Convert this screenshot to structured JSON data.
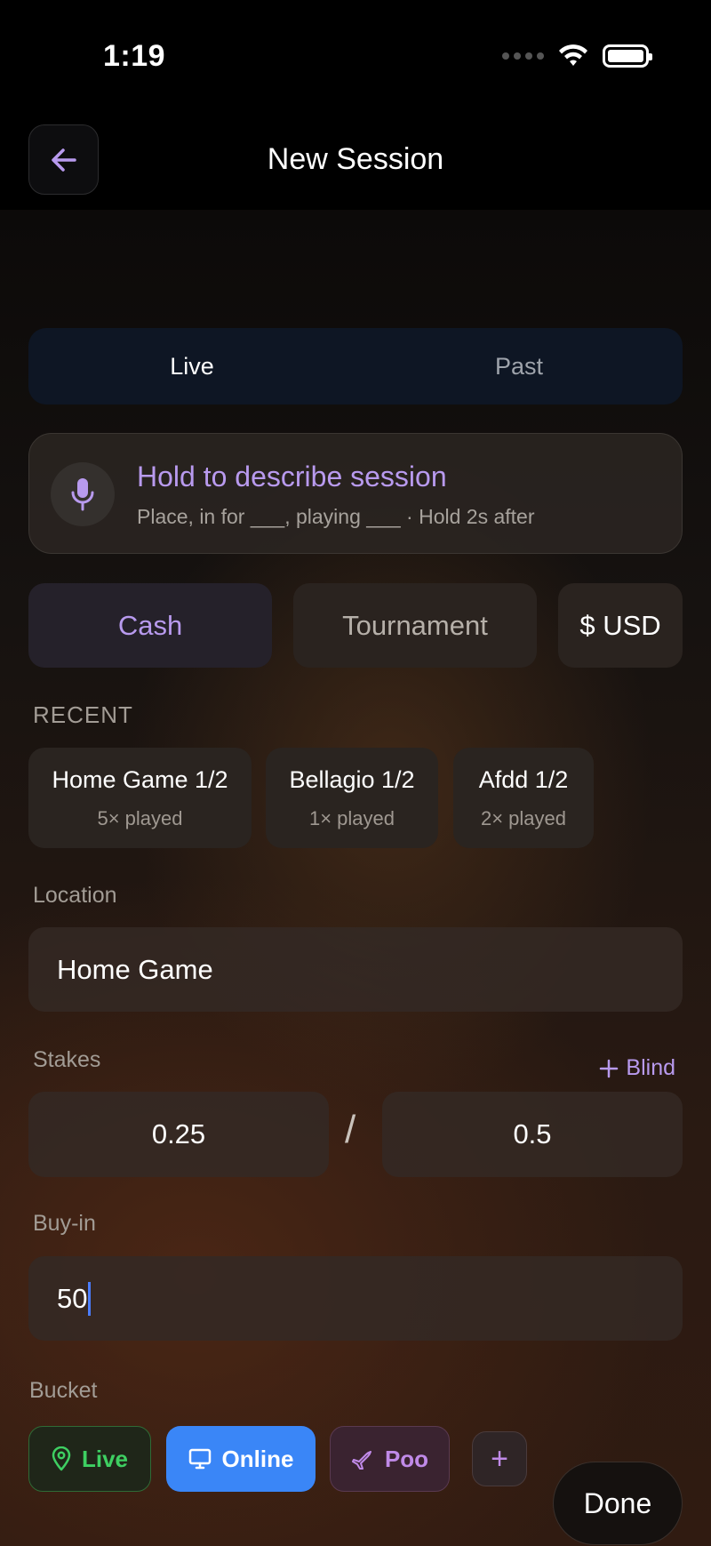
{
  "status_bar": {
    "time": "1:19"
  },
  "header": {
    "title": "New Session"
  },
  "mode_tabs": [
    {
      "label": "Live",
      "active": true
    },
    {
      "label": "Past",
      "active": false
    }
  ],
  "voice": {
    "title": "Hold to describe session",
    "subtitle": "Place, in for ___, playing ___  ·  Hold 2s after"
  },
  "game_type": {
    "cash_label": "Cash",
    "tournament_label": "Tournament",
    "currency_label": "$ USD",
    "selected": "Cash"
  },
  "recent": {
    "label": "RECENT",
    "items": [
      {
        "name": "Home Game 1/2",
        "count": "5× played"
      },
      {
        "name": "Bellagio 1/2",
        "count": "1× played"
      },
      {
        "name": "Afdd 1/2",
        "count": "2× played"
      }
    ]
  },
  "location": {
    "label": "Location",
    "value": "Home Game"
  },
  "stakes": {
    "label": "Stakes",
    "add_blind_label": "Blind",
    "small_blind": "0.25",
    "separator": "/",
    "big_blind": "0.5"
  },
  "buyin": {
    "label": "Buy-in",
    "value": "50"
  },
  "bucket": {
    "label": "Bucket",
    "items": [
      {
        "label": "Live",
        "icon": "map-pin-icon",
        "color": "#3ecf62"
      },
      {
        "label": "Online",
        "icon": "monitor-icon",
        "color": "#3a86f7",
        "selected": true
      },
      {
        "label": "Poo",
        "icon": "plane-icon",
        "color": "#c08ae8"
      }
    ],
    "add_label": "+"
  },
  "done_label": "Done",
  "colors": {
    "accent": "#b89aee",
    "blue": "#3a86f7",
    "green": "#3ecf62"
  }
}
